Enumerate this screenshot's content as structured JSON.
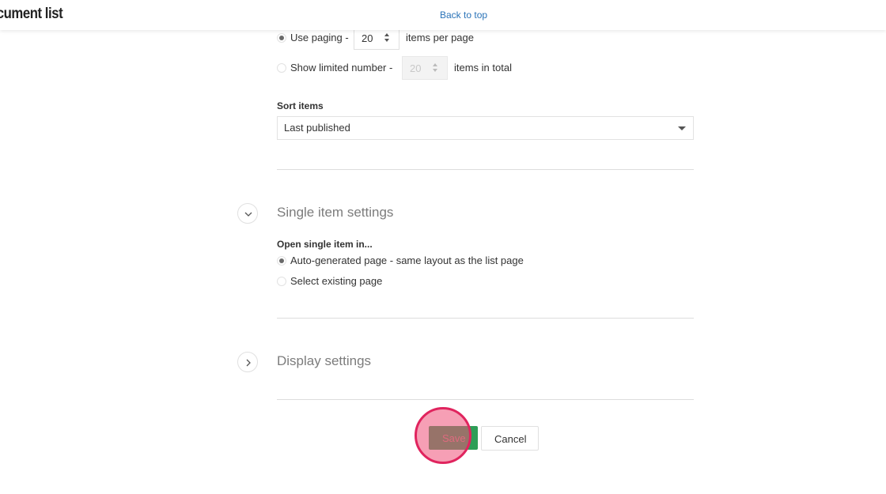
{
  "header": {
    "page_title": "ocument list",
    "back_link": "Back to top"
  },
  "paging": {
    "use_paging_label": "Use paging -",
    "use_paging_value": "20",
    "use_paging_suffix": "items per page",
    "use_paging_checked": true,
    "limited_label": "Show limited number -",
    "limited_value": "20",
    "limited_suffix": "items in total",
    "limited_checked": false
  },
  "sort": {
    "title": "Sort items",
    "selected": "Last published"
  },
  "single_item": {
    "section_title": "Single item settings",
    "expanded": true,
    "open_title": "Open single item in...",
    "options": [
      {
        "label": "Auto-generated page - same layout as the list page",
        "checked": true
      },
      {
        "label": "Select existing page",
        "checked": false
      }
    ]
  },
  "display": {
    "section_title": "Display settings",
    "expanded": false
  },
  "actions": {
    "save_label": "Save",
    "cancel_label": "Cancel"
  },
  "colors": {
    "accent_link": "#2a73b8",
    "save_button": "#2e9e57",
    "click_marker": "#e0245e"
  },
  "icons": {
    "section_expanded": "chevron-down-icon",
    "section_collapsed": "chevron-right-icon",
    "select_caret": "caret-down-icon",
    "stepper": "spinner-icon"
  }
}
